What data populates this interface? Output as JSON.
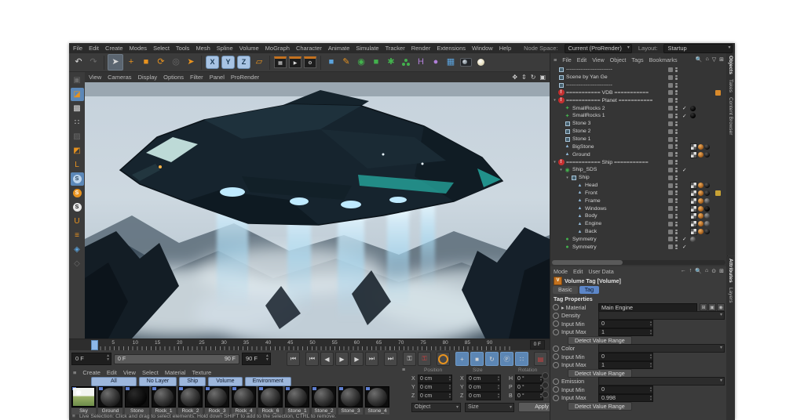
{
  "app": {
    "name": "Cinema 4D"
  },
  "menu_bar": {
    "items": [
      "File",
      "Edit",
      "Create",
      "Modes",
      "Select",
      "Tools",
      "Mesh",
      "Spline",
      "Volume",
      "MoGraph",
      "Character",
      "Animate",
      "Simulate",
      "Tracker",
      "Render",
      "Extensions",
      "Window",
      "Help"
    ],
    "node_space_label": "Node Space:",
    "node_space_value": "Current (ProRender)",
    "layout_label": "Layout:",
    "layout_value": "Startup",
    "search_icon": "magnifier-icon"
  },
  "toolbar": {
    "icons": [
      {
        "name": "undo",
        "glyph": "↶",
        "cls": "cw"
      },
      {
        "name": "redo",
        "glyph": "↷",
        "cls": "cd"
      },
      {
        "name": "sep"
      },
      {
        "name": "live-selection",
        "glyph": "➤",
        "cls": "cw",
        "hl": true
      },
      {
        "name": "move-tool",
        "glyph": "+",
        "cls": "co"
      },
      {
        "name": "scale-tool",
        "glyph": "■",
        "cls": "co"
      },
      {
        "name": "rotate-tool",
        "glyph": "⟳",
        "cls": "co"
      },
      {
        "name": "last-tool",
        "glyph": "◎",
        "cls": "cd"
      },
      {
        "name": "tweak-tool",
        "glyph": "➤",
        "cls": "co"
      },
      {
        "name": "sep"
      },
      {
        "name": "axis-x",
        "axis": "X"
      },
      {
        "name": "axis-y",
        "axis": "Y"
      },
      {
        "name": "axis-z",
        "axis": "Z"
      },
      {
        "name": "coord-system",
        "glyph": "▱",
        "cls": "co"
      },
      {
        "name": "sep"
      },
      {
        "name": "render-view",
        "clap": "▦"
      },
      {
        "name": "render-picture-viewer",
        "clap": "▶"
      },
      {
        "name": "render-settings",
        "clap": "⚙"
      },
      {
        "name": "sep"
      },
      {
        "name": "add-cube",
        "glyph": "■",
        "cls": "cb"
      },
      {
        "name": "pen-spline",
        "glyph": "✎",
        "cls": "co"
      },
      {
        "name": "subdivision-surface",
        "glyph": "◉",
        "cls": "cg"
      },
      {
        "name": "volume-builder",
        "glyph": "■",
        "cls": "cg"
      },
      {
        "name": "field-object",
        "glyph": "✱",
        "cls": "cg"
      },
      {
        "name": "cloner",
        "cluster": true
      },
      {
        "name": "deformer-h",
        "glyph": "H",
        "cls": "cp"
      },
      {
        "name": "spline-primitive",
        "glyph": "●",
        "cls": "cp"
      },
      {
        "name": "floor-environment",
        "glyph": "▦",
        "cls": "cb"
      },
      {
        "name": "camera",
        "cam": true
      },
      {
        "name": "light",
        "bulb": true
      }
    ]
  },
  "left_toolbar": {
    "icons": [
      {
        "name": "make-editable",
        "glyph": "▣",
        "cls": "cd"
      },
      {
        "name": "model-mode",
        "glyph": "◪",
        "cls": "co",
        "hl": true
      },
      {
        "name": "texture-mode",
        "glyph": "▩",
        "cls": "cw"
      },
      {
        "name": "point-mode",
        "glyph": "∷",
        "cls": "cw"
      },
      {
        "name": "edge-mode",
        "glyph": "▨",
        "cls": "cd"
      },
      {
        "name": "polygon-mode",
        "glyph": "◩",
        "cls": "co"
      },
      {
        "name": "enable-axis",
        "glyph": "L",
        "cls": "co"
      },
      {
        "name": "viewport-solo-off",
        "s": "blue"
      },
      {
        "name": "viewport-solo-single",
        "s": "orange"
      },
      {
        "name": "viewport-solo-hierarchy",
        "s": "white"
      },
      {
        "name": "snap",
        "glyph": "U",
        "cls": "co"
      },
      {
        "name": "quantize",
        "glyph": "≡",
        "cls": "co"
      },
      {
        "name": "workplane",
        "glyph": "◈",
        "cls": "cb"
      },
      {
        "name": "lock-workplane",
        "glyph": "◇",
        "cls": "cd"
      }
    ]
  },
  "viewport": {
    "menu": [
      "View",
      "Cameras",
      "Display",
      "Options",
      "Filter",
      "Panel",
      "ProRender"
    ],
    "corner_icons": [
      "pan-icon",
      "zoom-icon",
      "rotate-icon",
      "toggle-view-icon"
    ],
    "corner_glyphs": [
      "✥",
      "⇕",
      "↻",
      "▣"
    ]
  },
  "timeline": {
    "ticks": [
      "5",
      "10",
      "15",
      "20",
      "25",
      "30",
      "35",
      "40",
      "45",
      "50",
      "55",
      "60",
      "65",
      "70",
      "75",
      "80",
      "85",
      "90"
    ],
    "hud_frame": "0 F",
    "current_frame": "0 F",
    "range_start": "0 F",
    "range_end": "90 F",
    "end_frame": "90 F",
    "transport": [
      {
        "name": "goto-start",
        "glyph": "⏮"
      },
      {
        "name": "prev-key",
        "glyph": "⏮"
      },
      {
        "name": "prev-frame",
        "glyph": "◀"
      },
      {
        "name": "play",
        "glyph": "▶"
      },
      {
        "name": "next-frame",
        "glyph": "▶"
      },
      {
        "name": "next-key",
        "glyph": "⏭"
      },
      {
        "name": "goto-end",
        "glyph": "⏭"
      },
      {
        "name": "record-keyframe",
        "glyph": "⚿",
        "rec": false
      },
      {
        "name": "record-active",
        "glyph": "⚿",
        "rec": true
      },
      {
        "name": "autokey",
        "ring": true
      },
      {
        "name": "key-position",
        "glyph": "+",
        "hl": true
      },
      {
        "name": "key-scale",
        "glyph": "■",
        "hl": true
      },
      {
        "name": "key-rotation",
        "glyph": "↻",
        "hl": true
      },
      {
        "name": "key-parameter",
        "glyph": "Ⓟ",
        "hl": true
      },
      {
        "name": "key-pla",
        "glyph": "∷",
        "hl": true
      },
      {
        "name": "keyframe-presets",
        "glyph": "▤",
        "rec": true
      }
    ]
  },
  "materials": {
    "menu": [
      "Create",
      "Edit",
      "View",
      "Select",
      "Material",
      "Texture"
    ],
    "layers": [
      "All",
      "No Layer",
      "Ship",
      "Volume",
      "Environment"
    ],
    "items": [
      "Sky",
      "Ground",
      "Stone",
      "Rock_1",
      "Rock_2",
      "Rock_3",
      "Rock_4",
      "Rock_6",
      "Stone_1",
      "Stone_2",
      "Stone_3",
      "Stone_4"
    ]
  },
  "coordinates": {
    "headers": [
      "Position",
      "Size",
      "Rotation"
    ],
    "position": [
      [
        "X",
        "0 cm"
      ],
      [
        "Y",
        "0 cm"
      ],
      [
        "Z",
        "0 cm"
      ]
    ],
    "size": [
      [
        "X",
        "0 cm"
      ],
      [
        "Y",
        "0 cm"
      ],
      [
        "Z",
        "0 cm"
      ]
    ],
    "rotation": [
      [
        "H",
        "0 °"
      ],
      [
        "P",
        "0 °"
      ],
      [
        "B",
        "0 °"
      ]
    ],
    "dropdown_object": "Object",
    "dropdown_size": "Size",
    "apply_label": "Apply"
  },
  "status_bar": {
    "text": "Live Selection: Click and drag to select elements. Hold down SHIFT to add to the selection, CTRL to remove."
  },
  "object_manager": {
    "menu": [
      "File",
      "Edit",
      "View",
      "Object",
      "Tags",
      "Bookmarks"
    ],
    "corner_icons": [
      "search-icon",
      "home-icon",
      "filter-icon",
      "add-icon"
    ],
    "corner_glyphs": [
      "🔍",
      "⌂",
      "▽",
      "⊞"
    ],
    "side_tabs": [
      "Objects",
      "Takes",
      "Content Browser"
    ],
    "active_side_tab": "Objects",
    "rows": [
      {
        "name": "--------------------------",
        "icon": "null",
        "depth": 0
      },
      {
        "name": "Scene by Yan Ge",
        "icon": "null",
        "depth": 0
      },
      {
        "name": "--------------------------",
        "icon": "null",
        "depth": 0
      },
      {
        "name": "=========== VDB ===========",
        "icon": "alert",
        "depth": 0,
        "tag": "orange"
      },
      {
        "name": "=========== Planet ===========",
        "icon": "alert",
        "depth": 0,
        "exp": true
      },
      {
        "name": "SmallRocks 2",
        "icon": "gen",
        "depth": 1,
        "check": true,
        "spheres": [
          "black"
        ]
      },
      {
        "name": "SmallRocks 1",
        "icon": "gen",
        "depth": 1,
        "check": true,
        "spheres": [
          "black"
        ]
      },
      {
        "name": "Stone 3",
        "icon": "null",
        "depth": 1
      },
      {
        "name": "Stone 2",
        "icon": "null",
        "depth": 1
      },
      {
        "name": "Stone 1",
        "icon": "null",
        "depth": 1
      },
      {
        "name": "BigStone",
        "icon": "poly",
        "depth": 1,
        "checker": true,
        "spheres": [
          "orange",
          "dark"
        ]
      },
      {
        "name": "Ground",
        "icon": "poly",
        "depth": 1,
        "checker": true,
        "spheres": [
          "orange",
          "dark"
        ]
      },
      {
        "name": "=========== Ship ===========",
        "icon": "alert",
        "depth": 0,
        "exp": true
      },
      {
        "name": "Ship_SDS",
        "icon": "sds",
        "depth": 1,
        "check": true,
        "exp": true
      },
      {
        "name": "Ship",
        "icon": "null",
        "depth": 2,
        "exp": true
      },
      {
        "name": "Head",
        "icon": "poly",
        "depth": 3,
        "checker": true,
        "spheres": [
          "orange",
          "dark"
        ]
      },
      {
        "name": "Front",
        "icon": "poly",
        "depth": 3,
        "checker": true,
        "spheres": [
          "orange",
          "dark"
        ],
        "tag": "gold"
      },
      {
        "name": "Frame",
        "icon": "poly",
        "depth": 3,
        "checker": true,
        "spheres": [
          "orange",
          "grey"
        ]
      },
      {
        "name": "Windows",
        "icon": "poly",
        "depth": 3,
        "checker": true,
        "spheres": [
          "orange",
          "black"
        ]
      },
      {
        "name": "Body",
        "icon": "poly",
        "depth": 3,
        "checker": true,
        "spheres": [
          "orange",
          "grey"
        ]
      },
      {
        "name": "Engine",
        "icon": "poly",
        "depth": 3,
        "checker": true,
        "spheres": [
          "orange",
          "grey"
        ]
      },
      {
        "name": "Back",
        "icon": "poly",
        "depth": 3,
        "checker": true,
        "spheres": [
          "orange",
          "dark"
        ]
      },
      {
        "name": "Symmetry",
        "icon": "sym",
        "depth": 1,
        "check": true,
        "spheres": [
          "grey"
        ]
      },
      {
        "name": "Symmetry",
        "icon": "sym",
        "depth": 1,
        "check": true
      }
    ]
  },
  "attributes": {
    "menu": [
      "Mode",
      "Edit",
      "User Data"
    ],
    "corner_glyphs": [
      "←",
      "↑",
      "🔍",
      "⌂",
      "⊙",
      "⊞"
    ],
    "title": "Volume Tag [Volume]",
    "tabs": [
      "Basic",
      "Tag"
    ],
    "active_tab": "Tag",
    "section": "Tag Properties",
    "material_label": "Material",
    "material_value": "Main Engine",
    "side_tabs": [
      "Attributes",
      "Layers"
    ],
    "active_side_tab": "Attributes",
    "rows": [
      {
        "type": "material",
        "label": "Material",
        "value": "Main Engine"
      },
      {
        "type": "dropdown",
        "label": "Density"
      },
      {
        "type": "number",
        "label": "Input Min",
        "value": "0"
      },
      {
        "type": "number",
        "label": "Input Max",
        "value": "1"
      },
      {
        "type": "button",
        "label": "Detect Value Range"
      },
      {
        "type": "dropdown",
        "label": "Color"
      },
      {
        "type": "number",
        "label": "Input Min",
        "value": "0"
      },
      {
        "type": "number",
        "label": "Input Max",
        "value": "1"
      },
      {
        "type": "button",
        "label": "Detect Value Range"
      },
      {
        "type": "dropdown",
        "label": "Emission"
      },
      {
        "type": "number",
        "label": "Input Min",
        "value": "0"
      },
      {
        "type": "number",
        "label": "Input Max",
        "value": "0.998"
      },
      {
        "type": "button",
        "label": "Detect Value Range"
      }
    ]
  },
  "colors": {
    "accent_blue": "#5c86c8",
    "accent_orange": "#e8931f",
    "alert_red": "#c53030",
    "generator_green": "#43b14d",
    "layer_tab_blue": "#9db7dc",
    "beam_blue": "#aadcf5"
  }
}
